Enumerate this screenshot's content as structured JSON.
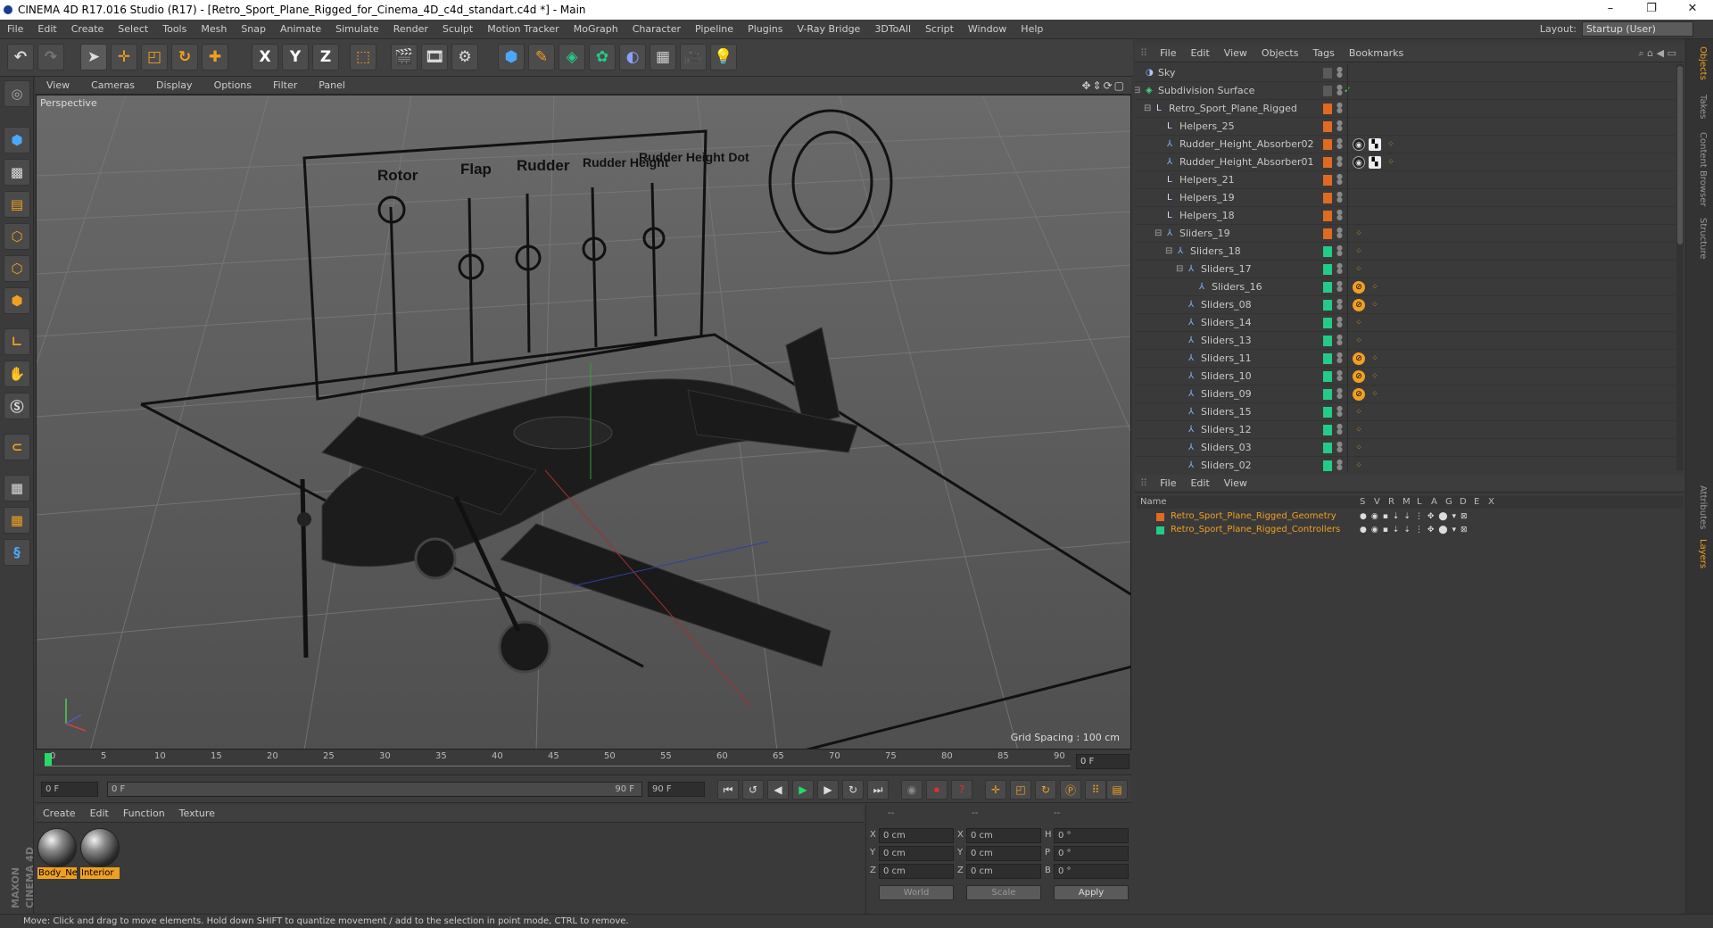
{
  "window": {
    "title": "CINEMA 4D R17.016 Studio (R17) - [Retro_Sport_Plane_Rigged_for_Cinema_4D_c4d_standart.c4d *] - Main",
    "min": "–",
    "max": "❐",
    "close": "✕"
  },
  "menubar": [
    "File",
    "Edit",
    "Create",
    "Select",
    "Tools",
    "Mesh",
    "Snap",
    "Animate",
    "Simulate",
    "Render",
    "Sculpt",
    "Motion Tracker",
    "MoGraph",
    "Character",
    "Pipeline",
    "Plugins",
    "V-Ray Bridge",
    "3DToAll",
    "Script",
    "Window",
    "Help"
  ],
  "layout": {
    "label": "Layout:",
    "value": "Startup (User)"
  },
  "toolbar": {
    "x": "X",
    "y": "Y",
    "z": "Z"
  },
  "viewport": {
    "menu": [
      "View",
      "Cameras",
      "Display",
      "Options",
      "Filter",
      "Panel"
    ],
    "label": "Perspective",
    "grid_spacing": "Grid Spacing : 100 cm",
    "panel_labels": [
      "Rotor",
      "Flap",
      "Rudder",
      "Rudder Height",
      "Rudder Height Dot"
    ]
  },
  "timeline": {
    "ticks": [
      "0",
      "5",
      "10",
      "15",
      "20",
      "25",
      "30",
      "35",
      "40",
      "45",
      "50",
      "55",
      "60",
      "65",
      "70",
      "75",
      "80",
      "85",
      "90"
    ],
    "frame": "0 F"
  },
  "playbar": {
    "start": "0 F",
    "range_start": "0 F",
    "range_end": "90 F",
    "end": "90 F"
  },
  "materials": {
    "menu": [
      "Create",
      "Edit",
      "Function",
      "Texture"
    ],
    "items": [
      "Body_Ne",
      "Interior"
    ]
  },
  "attributes": {
    "headers": [
      "--",
      "--",
      "--"
    ],
    "rows": [
      [
        "X",
        "0 cm",
        "X",
        "0 cm",
        "H",
        "0 °"
      ],
      [
        "Y",
        "0 cm",
        "Y",
        "0 cm",
        "P",
        "0 °"
      ],
      [
        "Z",
        "0 cm",
        "Z",
        "0 cm",
        "B",
        "0 °"
      ]
    ],
    "coord": "World",
    "mode": "Scale",
    "apply": "Apply"
  },
  "status": "Move: Click and drag to move elements. Hold down SHIFT to quantize movement / add to the selection in point mode, CTRL to remove.",
  "brand": "MAXON CINEMA 4D",
  "objects": {
    "menu": [
      "File",
      "Edit",
      "View",
      "Objects",
      "Tags",
      "Bookmarks"
    ],
    "rows": [
      {
        "name": "Sky",
        "indent": 0,
        "icon": "sky",
        "layer": ""
      },
      {
        "name": "Subdivision Surface",
        "indent": 0,
        "icon": "subd",
        "layer": ""
      },
      {
        "name": "Retro_Sport_Plane_Rigged",
        "indent": 1,
        "icon": "null",
        "layer": "#e06a20"
      },
      {
        "name": "Helpers_25",
        "indent": 2,
        "icon": "null",
        "layer": "#e06a20"
      },
      {
        "name": "Rudder_Height_Absorber02",
        "indent": 2,
        "icon": "joint",
        "layer": "#e06a20"
      },
      {
        "name": "Rudder_Height_Absorber01",
        "indent": 2,
        "icon": "joint",
        "layer": "#e06a20"
      },
      {
        "name": "Helpers_21",
        "indent": 2,
        "icon": "null",
        "layer": "#e06a20"
      },
      {
        "name": "Helpers_19",
        "indent": 2,
        "icon": "null",
        "layer": "#e06a20"
      },
      {
        "name": "Helpers_18",
        "indent": 2,
        "icon": "null",
        "layer": "#e06a20"
      },
      {
        "name": "Sliders_19",
        "indent": 2,
        "icon": "joint",
        "layer": "#e06a20"
      },
      {
        "name": "Sliders_18",
        "indent": 3,
        "icon": "joint",
        "layer": "#22cc88"
      },
      {
        "name": "Sliders_17",
        "indent": 4,
        "icon": "joint",
        "layer": "#22cc88"
      },
      {
        "name": "Sliders_16",
        "indent": 5,
        "icon": "joint",
        "layer": "#22cc88"
      },
      {
        "name": "Sliders_08",
        "indent": 4,
        "icon": "joint",
        "layer": "#22cc88"
      },
      {
        "name": "Sliders_14",
        "indent": 4,
        "icon": "joint",
        "layer": "#22cc88"
      },
      {
        "name": "Sliders_13",
        "indent": 4,
        "icon": "joint",
        "layer": "#22cc88"
      },
      {
        "name": "Sliders_11",
        "indent": 4,
        "icon": "joint",
        "layer": "#22cc88"
      },
      {
        "name": "Sliders_10",
        "indent": 4,
        "icon": "joint",
        "layer": "#22cc88"
      },
      {
        "name": "Sliders_09",
        "indent": 4,
        "icon": "joint",
        "layer": "#22cc88"
      },
      {
        "name": "Sliders_15",
        "indent": 4,
        "icon": "joint",
        "layer": "#22cc88"
      },
      {
        "name": "Sliders_12",
        "indent": 4,
        "icon": "joint",
        "layer": "#22cc88"
      },
      {
        "name": "Sliders_03",
        "indent": 4,
        "icon": "joint",
        "layer": "#22cc88"
      },
      {
        "name": "Sliders_02",
        "indent": 4,
        "icon": "joint",
        "layer": "#22cc88"
      }
    ]
  },
  "layers": {
    "menu": [
      "File",
      "Edit",
      "View"
    ],
    "columns": [
      "Name",
      "S",
      "V",
      "R",
      "M",
      "L",
      "A",
      "G",
      "D",
      "E",
      "X"
    ],
    "rows": [
      {
        "name": "Retro_Sport_Plane_Rigged_Geometry",
        "color": "#e06a20"
      },
      {
        "name": "Retro_Sport_Plane_Rigged_Controllers",
        "color": "#22cc88"
      }
    ]
  },
  "side_tabs": [
    "Objects",
    "Takes",
    "Content Browser",
    "Structure",
    "Attributes",
    "Layers"
  ]
}
